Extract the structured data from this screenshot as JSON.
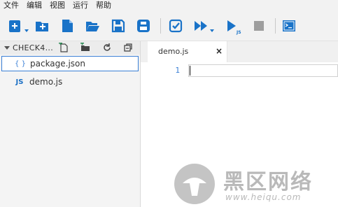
{
  "menu": {
    "items": [
      "文件",
      "编辑",
      "视图",
      "运行",
      "帮助"
    ]
  },
  "toolbar": {
    "icons": [
      "new-project-icon",
      "new-folder-icon",
      "new-file-icon",
      "open-folder-icon",
      "save-icon",
      "save-all-icon",
      "check-icon",
      "run-all-icon",
      "run-js-icon",
      "stop-icon",
      "terminal-icon"
    ],
    "accent": "#1a73c8",
    "run_js_badge": "JS"
  },
  "sidebar": {
    "project_title": "CHECK4...",
    "files": [
      {
        "icon_text": "{ }",
        "name": "package.json",
        "selected": true
      },
      {
        "icon_text": "JS",
        "name": "demo.js",
        "selected": false
      }
    ]
  },
  "editor": {
    "tab": {
      "label": "demo.js",
      "close": "×"
    },
    "line_number": "1"
  },
  "watermark": {
    "title": "黑区网络",
    "url": "www.heiqu.com"
  }
}
